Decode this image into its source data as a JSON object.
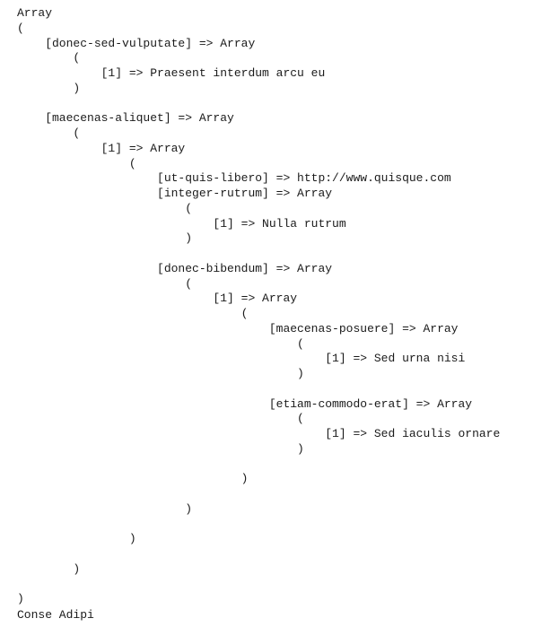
{
  "dump": {
    "lines": [
      "Array",
      "(",
      "    [donec-sed-vulputate] => Array",
      "        (",
      "            [1] => Praesent interdum arcu eu",
      "        )",
      "",
      "    [maecenas-aliquet] => Array",
      "        (",
      "            [1] => Array",
      "                (",
      "                    [ut-quis-libero] => http://www.quisque.com",
      "                    [integer-rutrum] => Array",
      "                        (",
      "                            [1] => Nulla rutrum",
      "                        )",
      "",
      "                    [donec-bibendum] => Array",
      "                        (",
      "                            [1] => Array",
      "                                (",
      "                                    [maecenas-posuere] => Array",
      "                                        (",
      "                                            [1] => Sed urna nisi",
      "                                        )",
      "",
      "                                    [etiam-commodo-erat] => Array",
      "                                        (",
      "                                            [1] => Sed iaculis ornare",
      "                                        )",
      "",
      "                                )",
      "",
      "                        )",
      "",
      "                )",
      "",
      "        )",
      "",
      ")"
    ]
  },
  "footer": {
    "text": "Conse Adipi"
  }
}
